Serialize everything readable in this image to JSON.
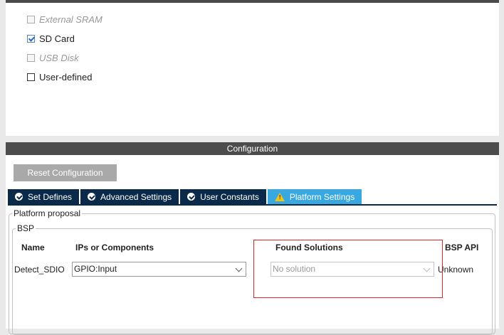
{
  "memory_options": [
    {
      "label": "External SRAM",
      "checked": false,
      "disabled": true
    },
    {
      "label": "SD Card",
      "checked": true,
      "disabled": false
    },
    {
      "label": "USB Disk",
      "checked": false,
      "disabled": true
    },
    {
      "label": "User-defined",
      "checked": false,
      "disabled": false
    }
  ],
  "configuration": {
    "title": "Configuration",
    "reset_label": "Reset Configuration",
    "tabs": [
      {
        "label": "Set Defines",
        "icon": "check-circle-icon",
        "active": false
      },
      {
        "label": "Advanced Settings",
        "icon": "check-circle-icon",
        "active": false
      },
      {
        "label": "User Constants",
        "icon": "check-circle-icon",
        "active": false
      },
      {
        "label": "Platform Settings",
        "icon": "warning-icon",
        "active": true
      }
    ]
  },
  "platform": {
    "group_label": "Platform proposal",
    "bsp_label": "BSP",
    "headers": {
      "name": "Name",
      "ips": "IPs or Components",
      "found": "Found Solutions",
      "bsp_api": "BSP API"
    },
    "rows": [
      {
        "name": "Detect_SDIO",
        "ip": "GPIO:Input",
        "solution": "No solution",
        "bsp_api": "Unknown"
      }
    ]
  },
  "colors": {
    "active_tab": "#3aa8e0",
    "tab": "#0b2a4a",
    "highlight": "#d42a2a",
    "header": "#4c4c4c"
  }
}
